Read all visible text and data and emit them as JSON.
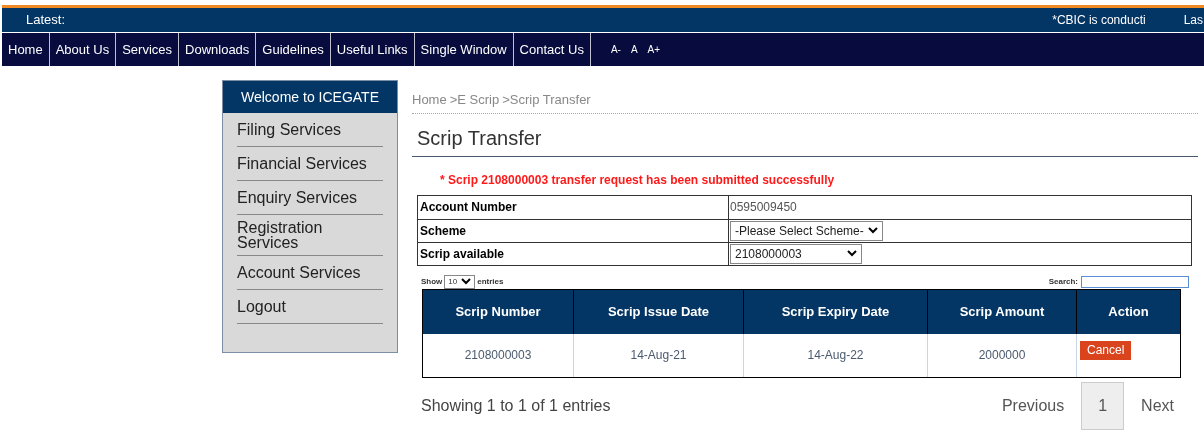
{
  "ticker": {
    "label": "Latest:",
    "messages": [
      "*CBIC is conducti",
      "Las"
    ]
  },
  "nav": {
    "items": [
      "Home",
      "About Us",
      "Services",
      "Downloads",
      "Guidelines",
      "Useful Links",
      "Single Window",
      "Contact Us"
    ],
    "font_sizes": [
      "A-",
      "A",
      "A+"
    ]
  },
  "sidebar": {
    "title": "Welcome to ICEGATE",
    "items": [
      "Filing Services",
      "Financial Services",
      "Enquiry Services",
      "Registration Services",
      "Account Services",
      "Logout"
    ]
  },
  "breadcrumb": [
    "Home",
    ">E Scrip",
    ">Scrip Transfer"
  ],
  "page_title": "Scrip Transfer",
  "message": "* Scrip 2108000003 transfer request has been submitted successfully",
  "form": [
    {
      "kind": "text",
      "label": "Account Number",
      "value": "0595009450"
    },
    {
      "kind": "select",
      "label": "Scheme",
      "value": "-Please Select Scheme-"
    },
    {
      "kind": "select",
      "label": "Scrip available",
      "value": "2108000003"
    }
  ],
  "table_controls": {
    "show_label": "Show",
    "page_size": "10",
    "entries_label": "entries",
    "search_label": "Search:"
  },
  "table": {
    "columns": [
      "Scrip Number",
      "Scrip Issue Date",
      "Scrip Expiry Date",
      "Scrip Amount",
      "Action"
    ],
    "rows": [
      {
        "cells": [
          "2108000003",
          "14-Aug-21",
          "14-Aug-22",
          "2000000"
        ],
        "action": "Cancel"
      }
    ]
  },
  "footer": {
    "info": "Showing 1 to 1 of 1 entries",
    "pages": [
      {
        "label": "Previous",
        "selected": false
      },
      {
        "label": "1",
        "selected": true
      },
      {
        "label": "Next",
        "selected": false
      }
    ]
  }
}
